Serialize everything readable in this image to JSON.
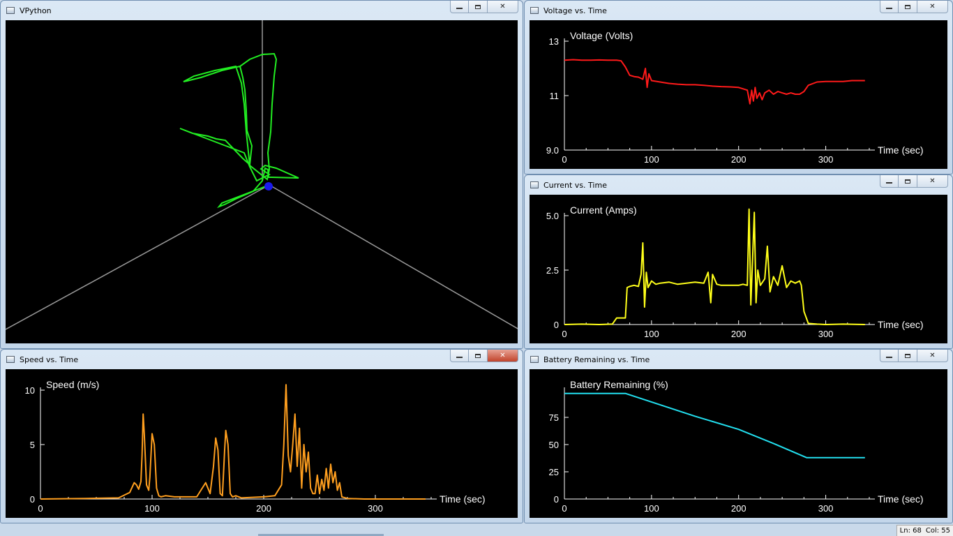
{
  "windows": {
    "vpython": {
      "title": "VPython"
    },
    "voltage": {
      "title": "Voltage vs. Time"
    },
    "current": {
      "title": "Current vs. Time"
    },
    "speed": {
      "title": "Speed vs. Time"
    },
    "battery": {
      "title": "Battery Remaining vs. Time"
    }
  },
  "controls": {
    "minimize": "—",
    "maximize": "□",
    "close": "✕"
  },
  "status": {
    "line": "Ln: 68",
    "col": "Col: 55"
  },
  "colors": {
    "voltage": "#ff1a1a",
    "current": "#ffff1a",
    "speed": "#ff9f1f",
    "battery": "#22e0f0",
    "path": "#22ee22",
    "ball": "#1a1aee",
    "axes": "#9a9a9a"
  },
  "chart_data": [
    {
      "id": "voltage",
      "type": "line",
      "title": "Voltage vs. Time",
      "ylabel": "Voltage (Volts)",
      "xlabel": "Time (sec)",
      "xlim": [
        0,
        350
      ],
      "ylim": [
        9.0,
        13
      ],
      "xticks": [
        0,
        100,
        200,
        300
      ],
      "yticks": [
        9.0,
        11,
        13
      ],
      "ytick_labels": [
        "9.0",
        "11",
        "13"
      ],
      "series": [
        {
          "x": [
            0,
            10,
            20,
            30,
            40,
            50,
            60,
            65,
            70,
            75,
            80,
            85,
            90,
            93,
            95,
            97,
            100,
            110,
            120,
            130,
            140,
            150,
            160,
            170,
            180,
            190,
            200,
            210,
            213,
            215,
            217,
            219,
            221,
            224,
            227,
            230,
            235,
            240,
            245,
            250,
            255,
            260,
            265,
            270,
            275,
            280,
            290,
            300,
            310,
            320,
            330,
            345
          ],
          "y": [
            12.3,
            12.32,
            12.3,
            12.3,
            12.31,
            12.3,
            12.3,
            12.28,
            12.05,
            11.75,
            11.7,
            11.68,
            11.6,
            12.0,
            11.3,
            11.8,
            11.55,
            11.5,
            11.45,
            11.42,
            11.4,
            11.4,
            11.38,
            11.35,
            11.33,
            11.32,
            11.3,
            11.2,
            10.7,
            11.2,
            10.8,
            11.3,
            10.9,
            11.1,
            10.85,
            11.1,
            11.2,
            11.05,
            11.15,
            11.1,
            11.05,
            11.1,
            11.05,
            11.05,
            11.15,
            11.38,
            11.5,
            11.52,
            11.52,
            11.52,
            11.55,
            11.55
          ]
        }
      ]
    },
    {
      "id": "current",
      "type": "line",
      "title": "Current vs. Time",
      "ylabel": "Current (Amps)",
      "xlabel": "Time (sec)",
      "xlim": [
        0,
        350
      ],
      "ylim": [
        0,
        5.0
      ],
      "xticks": [
        0,
        100,
        200,
        300
      ],
      "yticks": [
        0,
        2.5,
        5.0
      ],
      "ytick_labels": [
        "0",
        "2.5",
        "5.0"
      ],
      "series": [
        {
          "x": [
            0,
            20,
            40,
            55,
            60,
            65,
            70,
            72,
            75,
            80,
            85,
            88,
            90,
            92,
            94,
            96,
            100,
            105,
            110,
            120,
            130,
            140,
            150,
            160,
            165,
            168,
            170,
            175,
            180,
            190,
            200,
            205,
            210,
            212,
            214,
            216,
            218,
            220,
            222,
            225,
            230,
            233,
            236,
            240,
            245,
            250,
            255,
            260,
            265,
            270,
            272,
            275,
            280,
            290,
            300,
            320,
            345
          ],
          "y": [
            0,
            0.02,
            0,
            0.02,
            0.3,
            0.3,
            0.3,
            1.7,
            1.75,
            1.8,
            1.75,
            2.3,
            3.75,
            0.8,
            2.4,
            1.7,
            2.0,
            1.85,
            1.9,
            1.95,
            1.85,
            1.9,
            1.95,
            1.9,
            2.4,
            1.0,
            2.3,
            1.85,
            1.8,
            1.8,
            1.8,
            1.85,
            1.8,
            5.3,
            0.9,
            3.0,
            5.15,
            1.0,
            2.5,
            1.8,
            2.1,
            3.6,
            1.5,
            2.2,
            1.8,
            2.7,
            1.7,
            2.0,
            1.9,
            2.0,
            1.8,
            0.6,
            0.05,
            0.02,
            0,
            0.02,
            0
          ]
        }
      ]
    },
    {
      "id": "speed",
      "type": "line",
      "title": "Speed vs. Time",
      "ylabel": "Speed (m/s)",
      "xlabel": "Time (sec)",
      "xlim": [
        0,
        350
      ],
      "ylim": [
        0,
        10
      ],
      "xticks": [
        0,
        100,
        200,
        300
      ],
      "yticks": [
        0,
        5,
        10
      ],
      "ytick_labels": [
        "0",
        "5",
        "10"
      ],
      "series": [
        {
          "x": [
            0,
            40,
            70,
            80,
            84,
            86,
            88,
            90,
            91,
            92,
            93,
            95,
            97,
            98,
            100,
            102,
            104,
            106,
            108,
            112,
            120,
            140,
            148,
            152,
            155,
            157,
            159,
            161,
            163,
            165,
            166,
            168,
            170,
            172,
            175,
            180,
            200,
            210,
            216,
            218,
            220,
            222,
            224,
            226,
            228,
            230,
            232,
            234,
            236,
            238,
            240,
            242,
            244,
            246,
            248,
            250,
            252,
            254,
            256,
            258,
            260,
            262,
            264,
            266,
            268,
            270,
            275,
            290,
            320,
            345
          ],
          "y": [
            0,
            0.05,
            0.1,
            0.6,
            1.5,
            1.3,
            0.9,
            1.6,
            4.0,
            7.8,
            6.0,
            1.3,
            0.8,
            2.0,
            6.0,
            5.0,
            1.0,
            0.3,
            0.2,
            0.3,
            0.2,
            0.2,
            1.5,
            0.5,
            3.0,
            5.6,
            4.5,
            0.5,
            0.3,
            4.5,
            6.3,
            5.0,
            0.5,
            0.2,
            0.3,
            0.1,
            0.2,
            0.3,
            1.3,
            5.0,
            10.5,
            4.0,
            2.5,
            5.0,
            7.8,
            3.0,
            6.5,
            1.0,
            5.0,
            2.5,
            4.3,
            1.0,
            0.5,
            0.5,
            2.2,
            0.5,
            1.8,
            0.8,
            2.8,
            1.0,
            3.2,
            1.5,
            2.5,
            0.8,
            1.5,
            0.2,
            0.05,
            0,
            0,
            0
          ]
        }
      ]
    },
    {
      "id": "battery",
      "type": "line",
      "title": "Battery Remaining vs. Time",
      "ylabel": "Battery Remaining (%)",
      "xlabel": "Time (sec)",
      "xlim": [
        0,
        350
      ],
      "ylim": [
        0,
        100
      ],
      "xticks": [
        0,
        100,
        200,
        300
      ],
      "yticks": [
        0,
        25,
        50,
        75
      ],
      "ytick_labels": [
        "0",
        "25",
        "50",
        "75"
      ],
      "series": [
        {
          "x": [
            0,
            70,
            150,
            200,
            240,
            278,
            345
          ],
          "y": [
            97,
            97,
            76,
            64,
            51,
            38,
            38
          ]
        }
      ]
    }
  ],
  "scene3d": {
    "path": [
      [
        0,
        2
      ],
      [
        -5,
        0
      ],
      [
        -7,
        -2
      ],
      [
        -6,
        -4
      ],
      [
        -8,
        -6
      ],
      [
        -4,
        -8
      ],
      [
        -2,
        -10
      ],
      [
        -3,
        -12
      ],
      [
        0,
        -11
      ],
      [
        2,
        -10
      ],
      [
        0,
        -6
      ],
      [
        3,
        -3
      ],
      [
        2,
        -2
      ],
      [
        4,
        0
      ],
      [
        3,
        2
      ],
      [
        1,
        1
      ],
      [
        0,
        2
      ],
      [
        2,
        4
      ],
      [
        5,
        5
      ],
      [
        8,
        3
      ],
      [
        6,
        6
      ],
      [
        3,
        8
      ],
      [
        0,
        10
      ],
      [
        -3,
        12
      ],
      [
        -6,
        13
      ],
      [
        -8,
        14
      ],
      [
        -10,
        16
      ],
      [
        -14,
        18
      ],
      [
        -18,
        20
      ],
      [
        -20,
        22
      ],
      [
        -22,
        23
      ],
      [
        -24,
        23
      ],
      [
        -22,
        22
      ],
      [
        -18,
        24
      ],
      [
        -14,
        28
      ],
      [
        -12,
        30
      ],
      [
        -10,
        32
      ],
      [
        -6,
        34
      ],
      [
        -4,
        38
      ],
      [
        -3,
        42
      ],
      [
        -2,
        46
      ],
      [
        -1,
        50
      ],
      [
        0,
        54
      ],
      [
        1,
        56
      ],
      [
        2,
        57
      ],
      [
        3,
        58
      ],
      [
        4,
        58
      ],
      [
        3,
        55
      ],
      [
        2,
        50
      ],
      [
        1,
        45
      ],
      [
        0,
        40
      ],
      [
        -1,
        35
      ],
      [
        0,
        32
      ],
      [
        -1,
        28
      ],
      [
        0,
        24
      ],
      [
        -2,
        20
      ],
      [
        -1,
        16
      ],
      [
        0,
        12
      ],
      [
        1,
        8
      ],
      [
        0,
        4
      ],
      [
        0,
        2
      ]
    ],
    "ball": [
      0,
      0
    ],
    "scale": 0.4
  }
}
